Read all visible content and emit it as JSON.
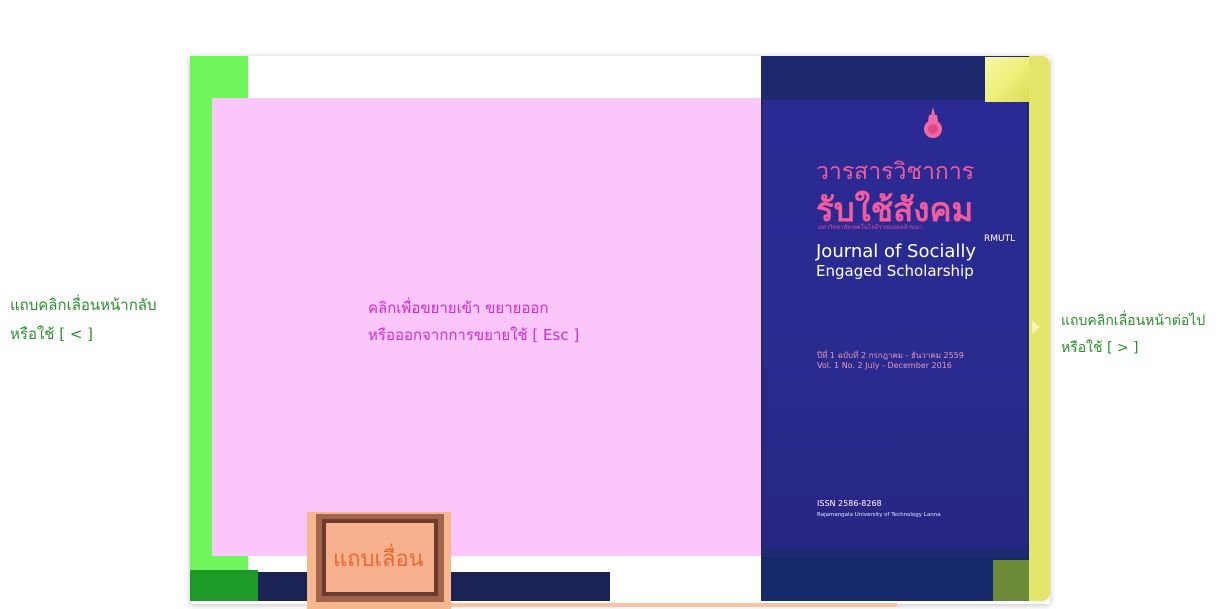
{
  "hints": {
    "prev_line1": "แถบคลิกเลื่อนหน้ากลับ",
    "prev_line2": "หรือใช้ [ < ]",
    "next_line1": "แถบคลิกเลื่อนหน้าต่อไป",
    "next_line2": "หรือใช้ [ > ]",
    "zoom_line1": "คลิกเพื่อขยายเข้า ขยายออก",
    "zoom_line2": "หรือออกจากการขยายใช้ [ Esc ]",
    "slider_label": "แถบเลื่อน"
  },
  "cover": {
    "title_th_1": "วารสารวิชาการ",
    "title_th_2": "รับใช้สังคม",
    "subtitle_th": "มหาวิทยาลัยเทคโนโลยีราชมงคลล้านนา",
    "abbr": "RMUTL",
    "title_en_1": "Journal of Socially",
    "title_en_2": "Engaged Scholarship",
    "issue_th": "ปีที่ 1 ฉบับที่ 2 กรกฎาคม - ธันวาคม 2559",
    "issue_en": "Vol. 1 No. 2 July - December 2016",
    "issn": "ISSN 2586-8268",
    "university": "Rajamangala University of Technology Lanna"
  },
  "colors": {
    "prev_strip": "#6ff55b",
    "zoom_area": "#fbc6f9",
    "next_strip": "#e4e56c",
    "cover_bg": "#2b2a94",
    "slider": "#f5b88f",
    "hint_text": "#2a8f2a"
  }
}
